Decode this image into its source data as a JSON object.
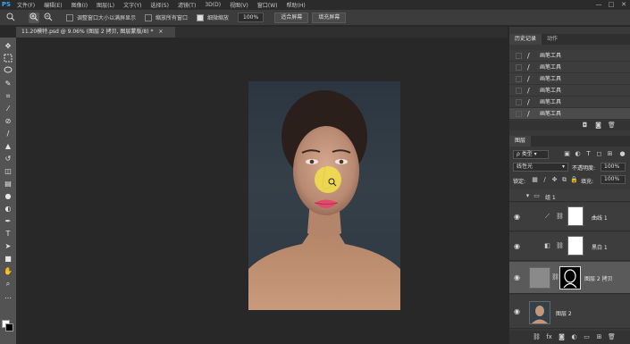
{
  "app": {
    "logo": "PS"
  },
  "menu": [
    "文件(F)",
    "编辑(E)",
    "图像(I)",
    "图层(L)",
    "文字(Y)",
    "选择(S)",
    "滤镜(T)",
    "3D(D)",
    "视图(V)",
    "窗口(W)",
    "帮助(H)"
  ],
  "window_buttons": [
    "—",
    "□",
    "✕"
  ],
  "options": {
    "resize_windows": "调整窗口大小以满屏显示",
    "zoom_all": "缩放所有窗口",
    "scrubby_zoom": "细微缩放",
    "zoom_value": "100%",
    "fit_screen": "适合屏幕",
    "fill_screen": "填充屏幕"
  },
  "document_tab": {
    "label": "11.20模特.psd @ 9.06% (图层 2 拷贝, 图层蒙版/8) *",
    "close": "×"
  },
  "history_panel": {
    "tabs": [
      "历史记录",
      "动作"
    ],
    "items": [
      "画笔工具",
      "画笔工具",
      "画笔工具",
      "画笔工具",
      "画笔工具",
      "画笔工具"
    ],
    "selected_index": 5
  },
  "layers_panel": {
    "title": "图层",
    "filter_kind": "类型",
    "blend_mode": "线性光",
    "opacity_label": "不透明度:",
    "opacity_value": "100%",
    "lock_label": "锁定:",
    "fill_label": "填充:",
    "fill_value": "100%",
    "layers": [
      {
        "name": "组 1",
        "kind": "group",
        "visible": false
      },
      {
        "name": "曲线 1",
        "kind": "adjustment",
        "visible": true
      },
      {
        "name": "黑白 1",
        "kind": "adjustment",
        "visible": true
      },
      {
        "name": "图层 2 拷贝",
        "kind": "pixel-with-mask",
        "visible": true,
        "selected": true
      },
      {
        "name": "图层 2",
        "kind": "pixel",
        "visible": true
      }
    ],
    "footer_icons": [
      "link-icon",
      "fx-icon",
      "mask-icon",
      "adjustment-icon",
      "folder-icon",
      "new-layer-icon",
      "trash-icon"
    ]
  },
  "colors": {
    "accent": "#31a8ff",
    "brush_cursor": "#f2e04a",
    "canvas_bg": "#282828",
    "panel_bg": "#393939"
  }
}
